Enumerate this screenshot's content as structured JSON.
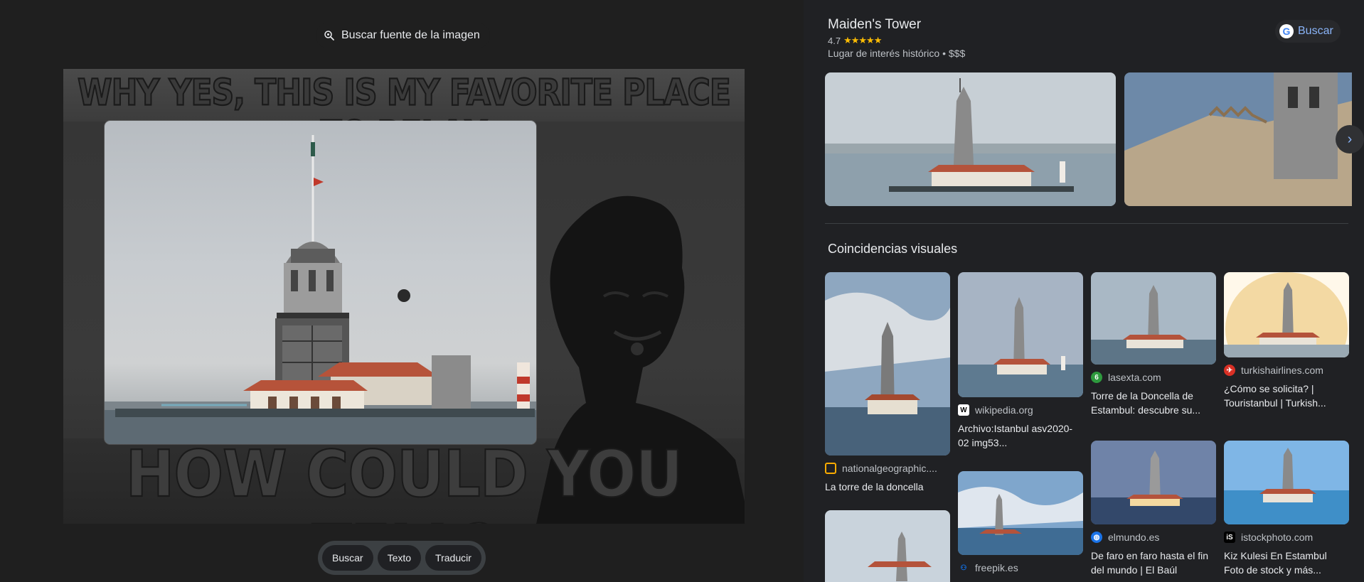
{
  "left": {
    "find_source_label": "Buscar fuente de la imagen",
    "meme_top_text": "WHY YES, THIS IS MY FAVORITE PLACE TO RELAX",
    "meme_bottom_text": "HOW COULD YOU TELL?",
    "toolbar": {
      "search_label": "Buscar",
      "text_label": "Texto",
      "translate_label": "Traducir"
    }
  },
  "right": {
    "place": {
      "title": "Maiden's Tower",
      "rating": "4.7",
      "stars": "★★★★★",
      "type": "Lugar de interés histórico • $$$"
    },
    "search_button_label": "Buscar",
    "visual_matches_title": "Coincidencias visuales",
    "matches": [
      {
        "source": "nationalgeographic....",
        "title": "La torre de la doncella",
        "favicon_color": "#f9ab00"
      },
      {
        "source": "wikipedia.org",
        "title": "Archivo:Istanbul asv2020-02 img53...",
        "favicon_color": "#ffffff"
      },
      {
        "source": "freepik.es",
        "title": "",
        "favicon_color": "#1273eb"
      },
      {
        "source": "lasexta.com",
        "title": "Torre de la Doncella de Estambul: descubre su...",
        "favicon_color": "#2e9a3e"
      },
      {
        "source": "elmundo.es",
        "title": "De faro en faro hasta el fin del mundo | El Baúl",
        "favicon_color": "#1a73e8"
      },
      {
        "source": "turkishairlines.com",
        "title": "¿Cómo se solicita? | Touristanbul | Turkish...",
        "favicon_color": "#d93025"
      },
      {
        "source": "istockphoto.com",
        "title": "Kiz Kulesi En Estambul Foto de stock y más...",
        "favicon_color": "#000000"
      }
    ]
  },
  "colors": {
    "background": "#202124",
    "link_blue": "#8ab4f8",
    "star_yellow": "#fbbc04"
  }
}
